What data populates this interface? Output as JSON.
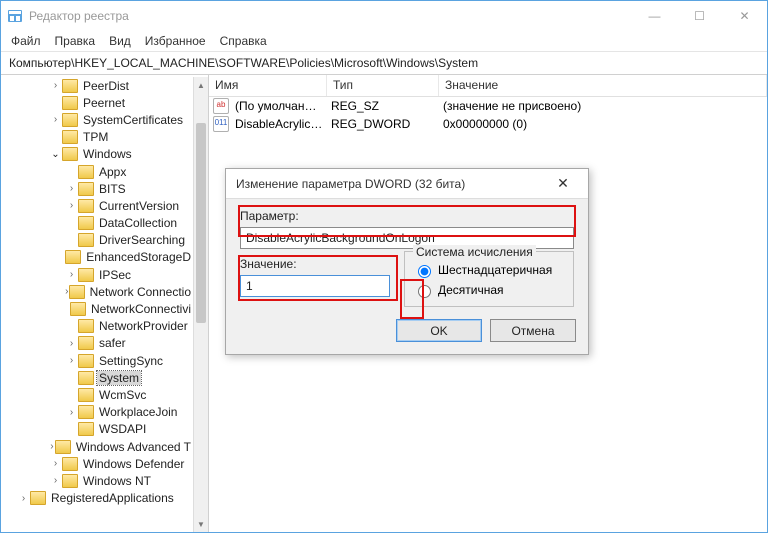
{
  "window": {
    "title": "Редактор реестра"
  },
  "menu": [
    "Файл",
    "Правка",
    "Вид",
    "Избранное",
    "Справка"
  ],
  "path": "Компьютер\\HKEY_LOCAL_MACHINE\\SOFTWARE\\Policies\\Microsoft\\Windows\\System",
  "columns": {
    "name": "Имя",
    "type": "Тип",
    "value": "Значение"
  },
  "rows": [
    {
      "icon": "str",
      "name": "(По умолчанию)",
      "type": "REG_SZ",
      "value": "(значение не присвоено)"
    },
    {
      "icon": "dw",
      "name": "DisableAcrylicBa...",
      "type": "REG_DWORD",
      "value": "0x00000000 (0)"
    }
  ],
  "tree": [
    {
      "d": 3,
      "tw": ">",
      "name": "PeerDist"
    },
    {
      "d": 3,
      "tw": "",
      "name": "Peernet"
    },
    {
      "d": 3,
      "tw": ">",
      "name": "SystemCertificates"
    },
    {
      "d": 3,
      "tw": "",
      "name": "TPM"
    },
    {
      "d": 3,
      "tw": "v",
      "name": "Windows"
    },
    {
      "d": 4,
      "tw": "",
      "name": "Appx"
    },
    {
      "d": 4,
      "tw": ">",
      "name": "BITS"
    },
    {
      "d": 4,
      "tw": ">",
      "name": "CurrentVersion"
    },
    {
      "d": 4,
      "tw": "",
      "name": "DataCollection"
    },
    {
      "d": 4,
      "tw": "",
      "name": "DriverSearching"
    },
    {
      "d": 4,
      "tw": "",
      "name": "EnhancedStorageD"
    },
    {
      "d": 4,
      "tw": ">",
      "name": "IPSec"
    },
    {
      "d": 4,
      "tw": ">",
      "name": "Network Connectio"
    },
    {
      "d": 4,
      "tw": "",
      "name": "NetworkConnectivi"
    },
    {
      "d": 4,
      "tw": "",
      "name": "NetworkProvider"
    },
    {
      "d": 4,
      "tw": ">",
      "name": "safer"
    },
    {
      "d": 4,
      "tw": ">",
      "name": "SettingSync"
    },
    {
      "d": 4,
      "tw": "",
      "name": "System",
      "sel": true
    },
    {
      "d": 4,
      "tw": "",
      "name": "WcmSvc"
    },
    {
      "d": 4,
      "tw": ">",
      "name": "WorkplaceJoin"
    },
    {
      "d": 4,
      "tw": "",
      "name": "WSDAPI"
    },
    {
      "d": 3,
      "tw": ">",
      "name": "Windows Advanced T"
    },
    {
      "d": 3,
      "tw": ">",
      "name": "Windows Defender"
    },
    {
      "d": 3,
      "tw": ">",
      "name": "Windows NT"
    },
    {
      "d": 1,
      "tw": ">",
      "name": "RegisteredApplications"
    }
  ],
  "dialog": {
    "title": "Изменение параметра DWORD (32 бита)",
    "param_label": "Параметр:",
    "param_value": "DisableAcrylicBackgroundOnLogon",
    "value_label": "Значение:",
    "value_value": "1",
    "system_label": "Система исчисления",
    "radio_hex": "Шестнадцатеричная",
    "radio_dec": "Десятичная",
    "ok": "OK",
    "cancel": "Отмена"
  }
}
